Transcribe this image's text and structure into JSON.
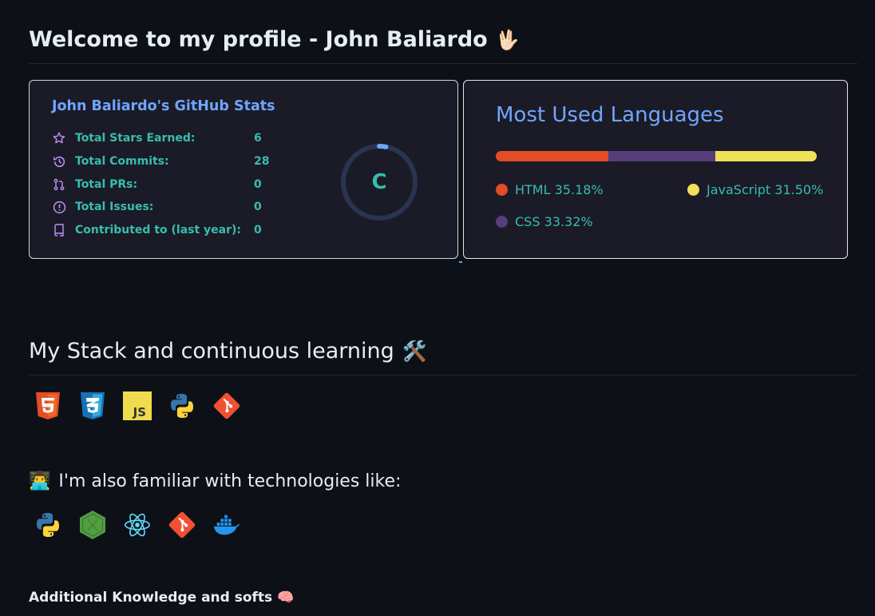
{
  "profile": {
    "welcome_title": "Welcome to my profile - John Baliardo",
    "wave_emoji": "🖖🏻"
  },
  "stats_card": {
    "title": "John Baliardo's GitHub Stats",
    "rows": [
      {
        "label": "Total Stars Earned:",
        "value": "6",
        "icon": "star-icon"
      },
      {
        "label": "Total Commits:",
        "value": "28",
        "icon": "history-icon"
      },
      {
        "label": "Total PRs:",
        "value": "0",
        "icon": "pull-request-icon"
      },
      {
        "label": "Total Issues:",
        "value": "0",
        "icon": "issue-icon"
      },
      {
        "label": "Contributed to (last year):",
        "value": "0",
        "icon": "repo-icon"
      }
    ],
    "grade": "C",
    "grade_progress": 0.03,
    "colors": {
      "title": "#70a5fd",
      "text": "#38bdae",
      "icon": "#bf91f3",
      "ring": "#70a5fd",
      "bg": "#1a1b27"
    }
  },
  "languages_card": {
    "title": "Most Used Languages",
    "languages": [
      {
        "name": "HTML",
        "percent": "35.18%",
        "value": 35.18,
        "color": "#e34c26"
      },
      {
        "name": "CSS",
        "percent": "33.32%",
        "value": 33.32,
        "color": "#563d7c"
      },
      {
        "name": "JavaScript",
        "percent": "31.50%",
        "value": 31.5,
        "color": "#f1e05a"
      }
    ]
  },
  "stack": {
    "title": "My Stack and continuous learning",
    "emoji": "🛠️",
    "icons": [
      "html5-icon",
      "css3-icon",
      "javascript-icon",
      "python-icon",
      "git-icon"
    ]
  },
  "familiar": {
    "emoji": "👨‍💻",
    "title": "I'm also familiar with technologies like:",
    "icons": [
      "python-icon",
      "nodejs-icon",
      "react-icon",
      "git-icon",
      "docker-icon"
    ]
  },
  "additional": {
    "title": "Additional Knowledge and softs",
    "emoji": "🧠"
  }
}
